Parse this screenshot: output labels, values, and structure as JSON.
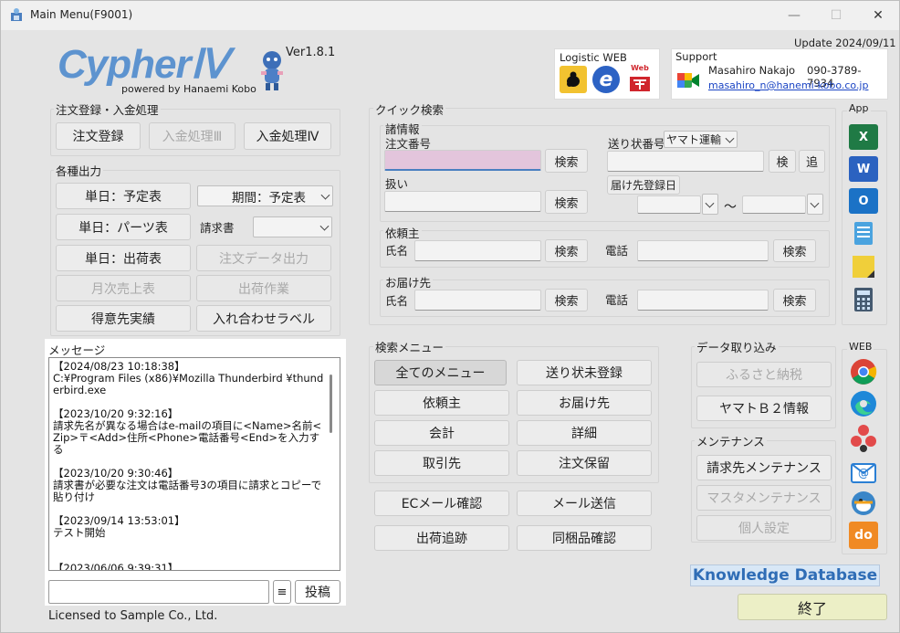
{
  "window": {
    "title": "Main Menu(F9001)",
    "minimize": "—",
    "maximize": "☐",
    "close": "✕"
  },
  "header": {
    "logo_text": "CypherⅣ",
    "logo_sub": "powered by Hanaemi Kobo",
    "version": "Ver1.8.1",
    "update": "Update 2024/09/11"
  },
  "logistics": {
    "label": "Logistic WEB",
    "icons": [
      "yamato-icon",
      "ecohai-icon",
      "japan-post-icon"
    ],
    "yamato_caption": "ヤマトクロネコ",
    "eco_caption": "e",
    "post_caption": "Web"
  },
  "support": {
    "label": "Support",
    "name": "Masahiro Nakajo",
    "phone": "090-3789-7934",
    "email": "masahiro_n@hanemi-kobo.co.jp"
  },
  "order_group": {
    "label": "注文登録・入金処理",
    "order_btn": "注文登録",
    "pay3_btn": "入金処理Ⅲ",
    "pay4_btn": "入金処理Ⅳ"
  },
  "output_group": {
    "label": "各種出力",
    "daily_plan": "単日：予定表",
    "period_select": "期間：予定表",
    "daily_parts": "単日：パーツ表",
    "invoice_label": "請求書",
    "invoice_select": "",
    "daily_ship": "単日：出荷表",
    "order_export": "注文データ出力",
    "monthly_sales": "月次売上表",
    "shipping_work": "出荷作業",
    "customer_results": "得意先実績",
    "insert_label": "入れ合わせラベル"
  },
  "messages": {
    "label": "メッセージ",
    "text": "【2024/08/23 10:18:38】\nC:¥Program Files (x86)¥Mozilla Thunderbird ¥thunderbird.exe\n\n【2023/10/20 9:32:16】\n請求先名が異なる場合はe-mailの項目に<Name>名前<Zip>〒<Add>住所<Phone>電話番号<End>を入力する\n\n【2023/10/20 9:30:46】\n請求書が必要な注文は電話番号3の項目に請求とコピーで貼り付け\n\n【2023/09/14 13:53:01】\nテスト開始\n\n\n【2023/06/06 9:39:31】",
    "input_value": "",
    "menu_btn": "≡",
    "post_btn": "投稿"
  },
  "license": "Licensed to Sample Co., Ltd.",
  "quick": {
    "label": "クイック検索",
    "info_label": "諸情報",
    "order_no_label": "注文番号",
    "order_no": "",
    "search": "検索",
    "handling_label": "扱い",
    "tracking_label": "送り状番号",
    "carrier": "ヤマト運輸",
    "ken": "検",
    "add": "追",
    "dest_date_btn": "届け先登録日",
    "tilde": "～",
    "client_label": "依頼主",
    "name_label": "氏名",
    "phone_label": "電話",
    "recipient_label": "お届け先"
  },
  "search_menu": {
    "label": "検索メニュー",
    "items": [
      "全てのメニュー",
      "送り状未登録",
      "依頼主",
      "お届け先",
      "会計",
      "詳細",
      "取引先",
      "注文保留"
    ],
    "ec_mail": "ECメール確認",
    "mail_send": "メール送信",
    "ship_track": "出荷追跡",
    "bundle": "同梱品確認"
  },
  "import": {
    "label": "データ取り込み",
    "furusato": "ふるさと納税",
    "yamato_b2": "ヤマトＢ２情報"
  },
  "maint": {
    "label": "メンテナンス",
    "billing": "請求先メンテナンス",
    "master": "マスタメンテナンス",
    "personal": "個人設定"
  },
  "app": {
    "label": "App",
    "icons": [
      "excel-icon",
      "word-icon",
      "outlook-icon",
      "notepad-icon",
      "sticky-notes-icon",
      "calculator-icon"
    ],
    "excel": "X",
    "word": "W",
    "outlook": "O"
  },
  "web": {
    "label": "WEB",
    "icons": [
      "chrome-icon",
      "edge-icon",
      "flower-icon",
      "mail-at-icon",
      "duck-icon",
      "do-icon"
    ],
    "do_text": "do"
  },
  "knowledge": "Knowledge Database",
  "exit": "終了",
  "colors": {
    "accent": "#4a7fc0",
    "order_input": "#e3c5dc",
    "exit_bg": "#ecefc6"
  }
}
